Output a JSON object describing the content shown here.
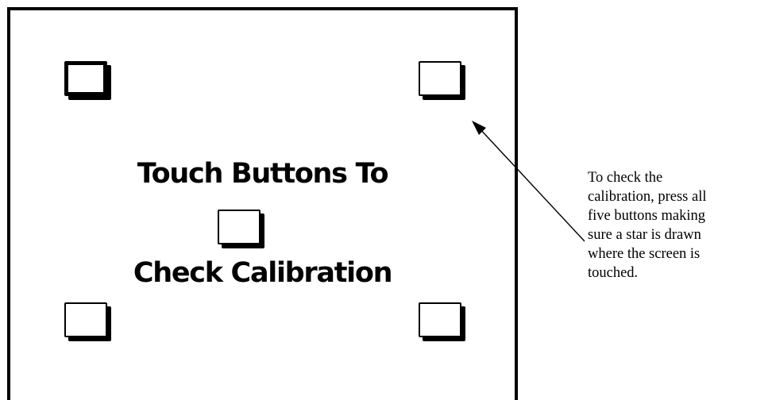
{
  "calibration_screen": {
    "heading_line1": "Touch Buttons To",
    "heading_line2": "Check Calibration",
    "buttons": [
      {
        "id": "top-left",
        "selected": true
      },
      {
        "id": "top-right",
        "selected": false
      },
      {
        "id": "center",
        "selected": false
      },
      {
        "id": "bottom-left",
        "selected": false
      },
      {
        "id": "bottom-right",
        "selected": false
      }
    ]
  },
  "annotation": {
    "text": "To check the\ncalibration, press all\nfive buttons making\nsure a star is drawn\nwhere the screen is\ntouched."
  },
  "colors": {
    "foreground": "#000000",
    "background": "#ffffff"
  }
}
